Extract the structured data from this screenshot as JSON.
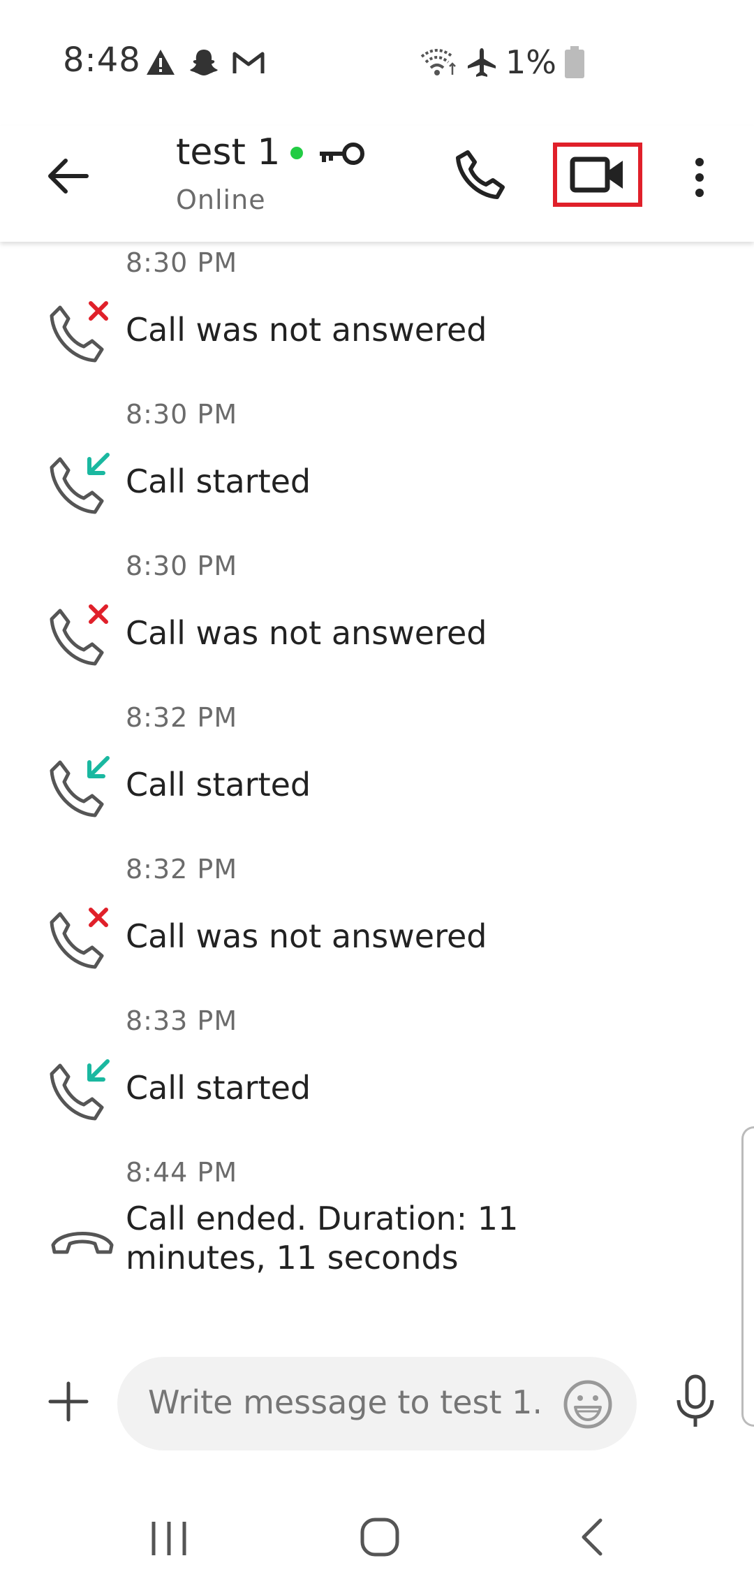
{
  "status_bar": {
    "time": "8:48",
    "battery": "1%",
    "icons_left": [
      "warning-icon",
      "snapchat-icon",
      "gmail-icon"
    ],
    "icons_right": [
      "wifi-icon",
      "airplane-icon",
      "battery-icon"
    ]
  },
  "header": {
    "contact_name": "test 1",
    "contact_status": "Online",
    "presence_color": "#22cc44",
    "highlight_color": "#e0202a"
  },
  "messages": [
    {
      "time": "8:30 PM",
      "text": "Call was not answered",
      "kind": "missed"
    },
    {
      "time": "8:30 PM",
      "text": "Call started",
      "kind": "incoming"
    },
    {
      "time": "8:30 PM",
      "text": "Call was not answered",
      "kind": "missed"
    },
    {
      "time": "8:32 PM",
      "text": "Call started",
      "kind": "incoming"
    },
    {
      "time": "8:32 PM",
      "text": "Call was not answered",
      "kind": "missed"
    },
    {
      "time": "8:33 PM",
      "text": "Call started",
      "kind": "incoming"
    },
    {
      "time": "8:44 PM",
      "text": "Call ended. Duration: 11 minutes, 11 seconds",
      "kind": "ended"
    }
  ],
  "composer": {
    "placeholder": "Write message to test 1..."
  },
  "colors": {
    "missed": "#e0202a",
    "incoming": "#1ab8a0"
  }
}
